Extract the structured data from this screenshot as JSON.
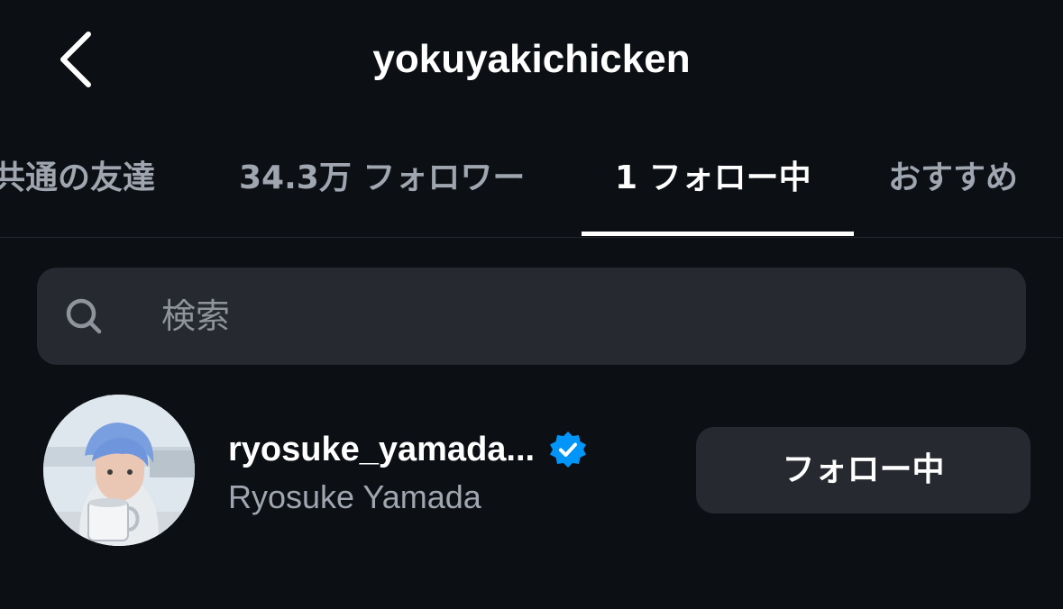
{
  "header": {
    "title": "yokuyakichicken",
    "back_icon": "chevron-left-icon"
  },
  "tabs": [
    {
      "label": "共通の友達",
      "active": false
    },
    {
      "label": "34.3万 フォロワー",
      "active": false
    },
    {
      "label": "1 フォロー中",
      "active": true
    },
    {
      "label": "おすすめ",
      "active": false
    }
  ],
  "search": {
    "placeholder": "検索",
    "icon": "search-icon"
  },
  "users": [
    {
      "username": "ryosuke_yamada...",
      "full_name": "Ryosuke Yamada",
      "verified": true,
      "button_label": "フォロー中"
    }
  ],
  "colors": {
    "background": "#0c0f14",
    "surface": "#26292f",
    "text_primary": "#ffffff",
    "text_secondary": "#a0a6b0",
    "verified_blue": "#0095f6",
    "tab_indicator": "#ffffff"
  }
}
